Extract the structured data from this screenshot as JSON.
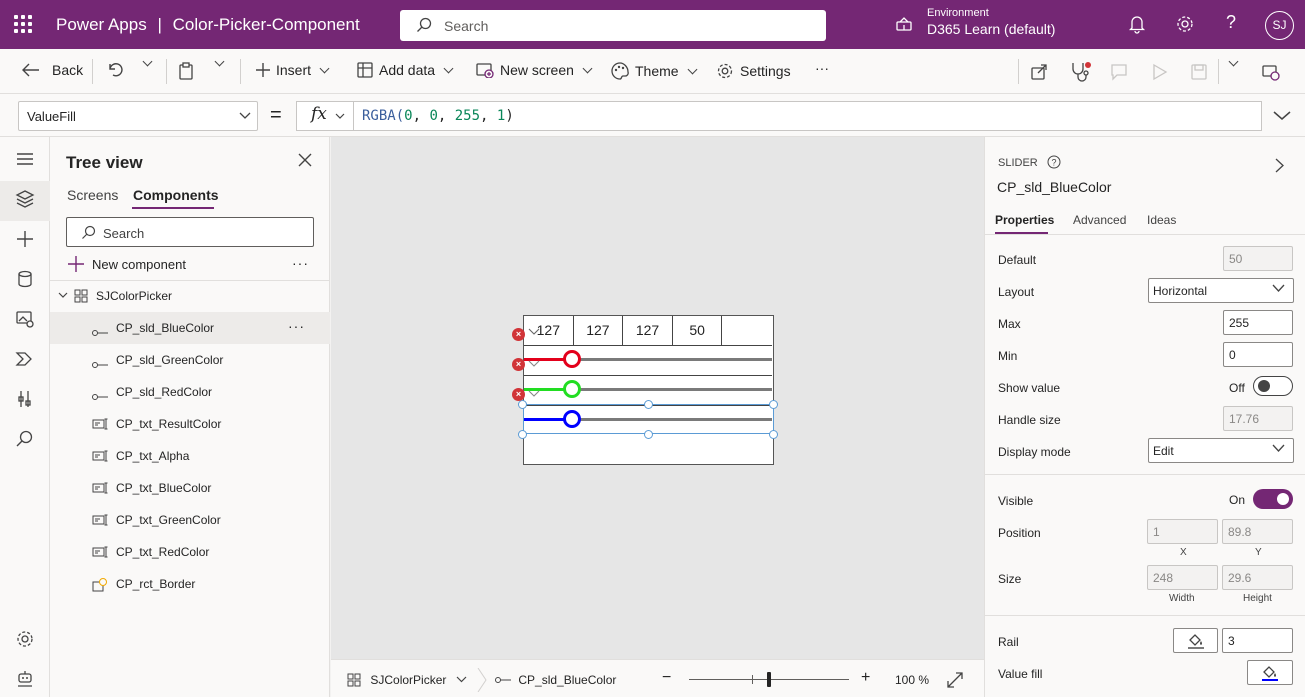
{
  "header": {
    "app_name": "Power Apps",
    "separator": "|",
    "app_title": "Color-Picker-Component",
    "search_placeholder": "Search",
    "environment_label": "Environment",
    "environment_value": "D365 Learn (default)",
    "avatar_initials": "SJ",
    "bg_color": "#742774"
  },
  "commands": {
    "back": "Back",
    "insert": "Insert",
    "add_data": "Add data",
    "new_screen": "New screen",
    "theme": "Theme",
    "settings": "Settings",
    "more": "···"
  },
  "formula_bar": {
    "property": "ValueFill",
    "equals": "=",
    "fx": "fx",
    "fn": "RGBA(",
    "a0": "0",
    "c1": ", ",
    "a1": "0",
    "c2": ", ",
    "a2": "255",
    "c3": ", ",
    "a3": "1",
    "close": ")"
  },
  "tree": {
    "title": "Tree view",
    "tabs": [
      "Screens",
      "Components"
    ],
    "search_placeholder": "Search",
    "new_component": "New component",
    "more": "···",
    "root": "SJColorPicker",
    "items": [
      {
        "label": "CP_sld_BlueColor",
        "icon": "slider-icon"
      },
      {
        "label": "CP_sld_GreenColor",
        "icon": "slider-icon"
      },
      {
        "label": "CP_sld_RedColor",
        "icon": "slider-icon"
      },
      {
        "label": "CP_txt_ResultColor",
        "icon": "text-input-icon"
      },
      {
        "label": "CP_txt_Alpha",
        "icon": "text-input-icon"
      },
      {
        "label": "CP_txt_BlueColor",
        "icon": "text-input-icon"
      },
      {
        "label": "CP_txt_GreenColor",
        "icon": "text-input-icon"
      },
      {
        "label": "CP_txt_RedColor",
        "icon": "text-input-icon"
      },
      {
        "label": "CP_rct_Border",
        "icon": "rectangle-icon"
      }
    ],
    "selected_more": "···"
  },
  "canvas": {
    "cells": [
      "127",
      "127",
      "127",
      "50",
      ""
    ],
    "sliders": [
      {
        "color": "#e3001b",
        "value_fraction": 0.2
      },
      {
        "color": "#22dd22",
        "value_fraction": 0.2
      },
      {
        "color": "#0000ff",
        "value_fraction": 0.2
      }
    ],
    "error_glyph": "×"
  },
  "statusbar": {
    "screen": "SJColorPicker",
    "control": "CP_sld_BlueColor",
    "zoom_minus": "−",
    "zoom_plus": "+",
    "zoom": "100 %",
    "zoom_fraction": 0.5
  },
  "properties": {
    "type": "SLIDER",
    "name": "CP_sld_BlueColor",
    "tabs": [
      "Properties",
      "Advanced",
      "Ideas"
    ],
    "default_label": "Default",
    "default_value": "50",
    "layout_label": "Layout",
    "layout_value": "Horizontal",
    "max_label": "Max",
    "max_value": "255",
    "min_label": "Min",
    "min_value": "0",
    "show_value_label": "Show value",
    "show_value_state": "Off",
    "handle_size_label": "Handle size",
    "handle_size_value": "17.76",
    "display_mode_label": "Display mode",
    "display_mode_value": "Edit",
    "visible_label": "Visible",
    "visible_state": "On",
    "position_label": "Position",
    "position_x": "1",
    "position_y": "89.8",
    "x_label": "X",
    "y_label": "Y",
    "size_label": "Size",
    "size_width": "248",
    "size_height": "29.6",
    "width_label": "Width",
    "height_label": "Height",
    "rail_label": "Rail",
    "rail_value": "3",
    "value_fill_label": "Value fill",
    "value_fill_color": "#0000ff"
  }
}
